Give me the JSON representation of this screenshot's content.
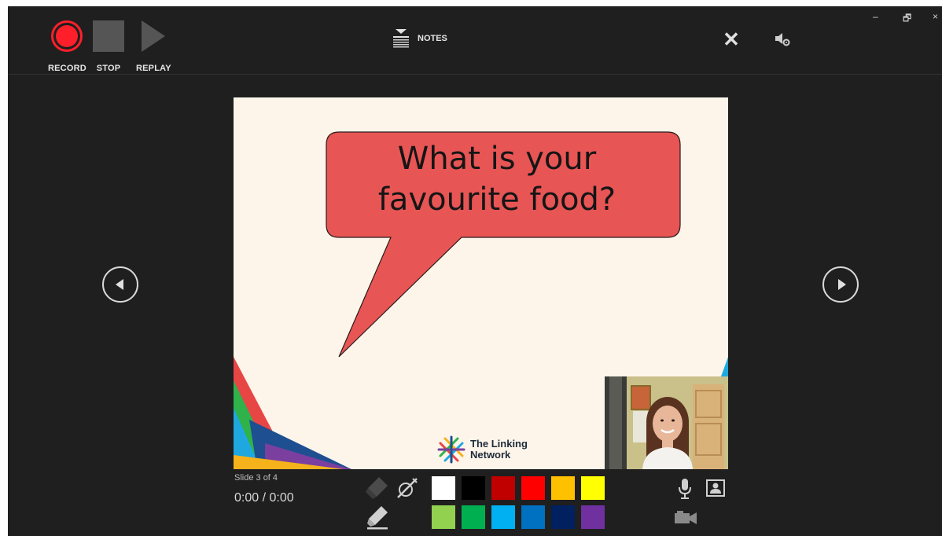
{
  "toolbar": {
    "record_label": "RECORD",
    "stop_label": "STOP",
    "replay_label": "REPLAY",
    "notes_label": "NOTES"
  },
  "window_controls": [
    "–",
    "🗗",
    "×"
  ],
  "slide": {
    "question_line1": "What is your",
    "question_line2": "favourite food?",
    "logo_line1": "The Linking",
    "logo_line2": "Network"
  },
  "status": {
    "slide_counter": "Slide 3 of 4",
    "timer": "0:00 / 0:00"
  },
  "pen_colors": [
    "#ffffff",
    "#000000",
    "#c00000",
    "#ff0000",
    "#ffc000",
    "#ffff00",
    "#92d050",
    "#00b050",
    "#00b0f0",
    "#0070c0",
    "#002060",
    "#7030a0"
  ],
  "icons": {
    "record": "record-icon",
    "stop": "stop-icon",
    "replay": "replay-icon",
    "notes": "notes-icon",
    "close": "close-icon",
    "audio_settings": "audio-settings-icon",
    "prev": "previous-slide-icon",
    "next": "next-slide-icon",
    "eraser": "eraser-icon",
    "pen": "pen-icon",
    "highlighter": "highlighter-icon",
    "microphone": "microphone-icon",
    "camera_preview": "camera-preview-icon",
    "camera": "camera-icon"
  },
  "colors": {
    "background": "#1f1f1f",
    "record_red": "#ff1f2a",
    "bubble_red": "#e85555",
    "slide_bg": "#fdf5ea"
  }
}
